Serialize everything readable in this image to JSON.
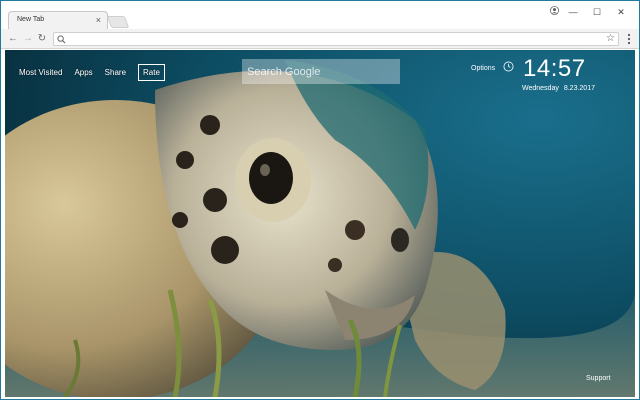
{
  "browser": {
    "tab_title": "New Tab",
    "tab_close": "×",
    "win_minimize": "—",
    "win_maximize": "☐",
    "win_close": "✕",
    "omnibox_value": "",
    "icons": [
      "user-icon",
      "back-icon",
      "forward-icon",
      "reload-icon",
      "search-icon",
      "star-icon",
      "menu-icon"
    ]
  },
  "newtab": {
    "nav": {
      "most_visited": "Most Visited",
      "apps": "Apps",
      "share": "Share",
      "rate": "Rate"
    },
    "search": {
      "placeholder": "Search Google"
    },
    "options_label": "Options",
    "time": "14:57",
    "weekday": "Wednesday",
    "date": "8.23.2017",
    "support_label": "Support"
  },
  "colors": {
    "frame": "#1f7a9c",
    "water": "#0d4d63",
    "text": "#ffffff"
  }
}
